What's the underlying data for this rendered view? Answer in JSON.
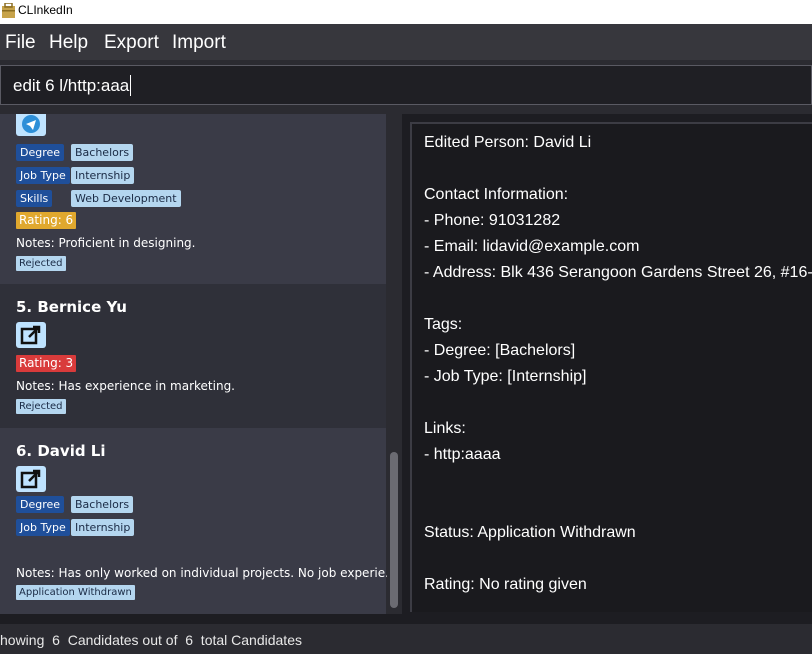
{
  "window": {
    "title": "CLInkedIn"
  },
  "menu": {
    "items": [
      "File",
      "Help",
      "Export",
      "Import"
    ]
  },
  "command": {
    "value": "edit 6 l/http:aaa"
  },
  "list": {
    "card4": {
      "tags": [
        {
          "key": "Degree",
          "value": "Bachelors"
        },
        {
          "key": "Job Type",
          "value": "Internship"
        },
        {
          "key": "Skills",
          "value": "Web Development"
        }
      ],
      "rating": "Rating: 6",
      "rating_color": "#e0a82e",
      "notes": "Notes: Proficient in designing.",
      "status": "Rejected"
    },
    "card5": {
      "name": "5.  Bernice Yu",
      "rating": "Rating: 3",
      "rating_color": "#d93b3b",
      "notes": "Notes: Has experience in marketing.",
      "status": "Rejected"
    },
    "card6": {
      "name": "6.  David Li",
      "tags": [
        {
          "key": "Degree",
          "value": "Bachelors"
        },
        {
          "key": "Job Type",
          "value": "Internship"
        }
      ],
      "notes": "Notes: Has only worked on individual projects. No job experie...",
      "status": "Application Withdrawn"
    }
  },
  "detail": {
    "edited": "Edited Person: David Li",
    "contact_heading": "Contact Information:",
    "phone": "- Phone: 91031282",
    "email": "- Email: lidavid@example.com",
    "address": "- Address: Blk 436 Serangoon Gardens Street 26, #16-",
    "tags_heading": "Tags:",
    "tag_degree": "- Degree: [Bachelors]",
    "tag_jobtype": "- Job Type: [Internship]",
    "links_heading": "Links:",
    "link1": "- http:aaaa",
    "status": "Status: Application Withdrawn",
    "rating": "Rating: No rating given"
  },
  "statusbar": {
    "text": "howing  6  Candidates out of  6  total Candidates"
  },
  "icons": [
    "app-icon",
    "telegram-icon",
    "external-link-icon"
  ]
}
